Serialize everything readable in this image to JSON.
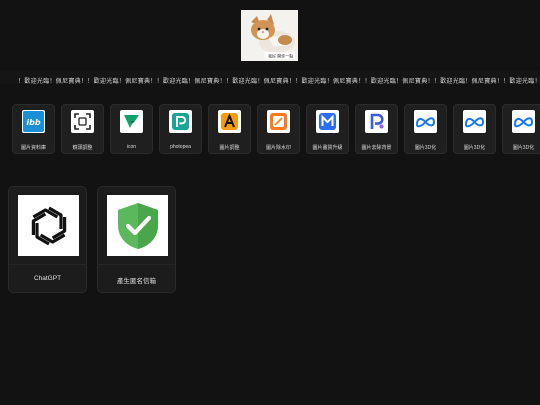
{
  "header": {
    "logo_caption": "我好 開你一點"
  },
  "marquee": {
    "text": "！歡迎光臨！佩尼寶典！！歡迎光臨！佩尼寶典！！歡迎光臨！佩尼寶典！！歡迎光臨！佩尼寶典！！歡迎光臨！佩尼寶典！！歡迎光臨！佩尼寶典！！歡迎光臨！佩尼寶典！！歡迎光臨！"
  },
  "tools": [
    {
      "label": "圖片資料庫",
      "icon": "ibb-icon"
    },
    {
      "label": "鏡頭調整",
      "icon": "scan-icon"
    },
    {
      "label": "icon",
      "icon": "vector-v-icon"
    },
    {
      "label": "photopea",
      "icon": "photopea-icon"
    },
    {
      "label": "圖片調整",
      "icon": "a-letter-icon"
    },
    {
      "label": "圖片除水印",
      "icon": "watermark-remove-icon"
    },
    {
      "label": "圖片畫質升級",
      "icon": "m-logo-icon"
    },
    {
      "label": "圖片去除背景",
      "icon": "p-logo-icon"
    },
    {
      "label": "圖片3D化",
      "icon": "meta-icon"
    },
    {
      "label": "圖片3D化",
      "icon": "meta-icon"
    },
    {
      "label": "圖片3D化",
      "icon": "meta-icon"
    }
  ],
  "cards": [
    {
      "label": "ChatGPT",
      "icon": "openai-icon"
    },
    {
      "label": "產生匿名信箱",
      "icon": "shield-check-icon"
    }
  ],
  "colors": {
    "background": "#121212",
    "card": "#1f1f1f",
    "meta_blue": "#1877f2",
    "shield_green": "#5cb85c"
  }
}
